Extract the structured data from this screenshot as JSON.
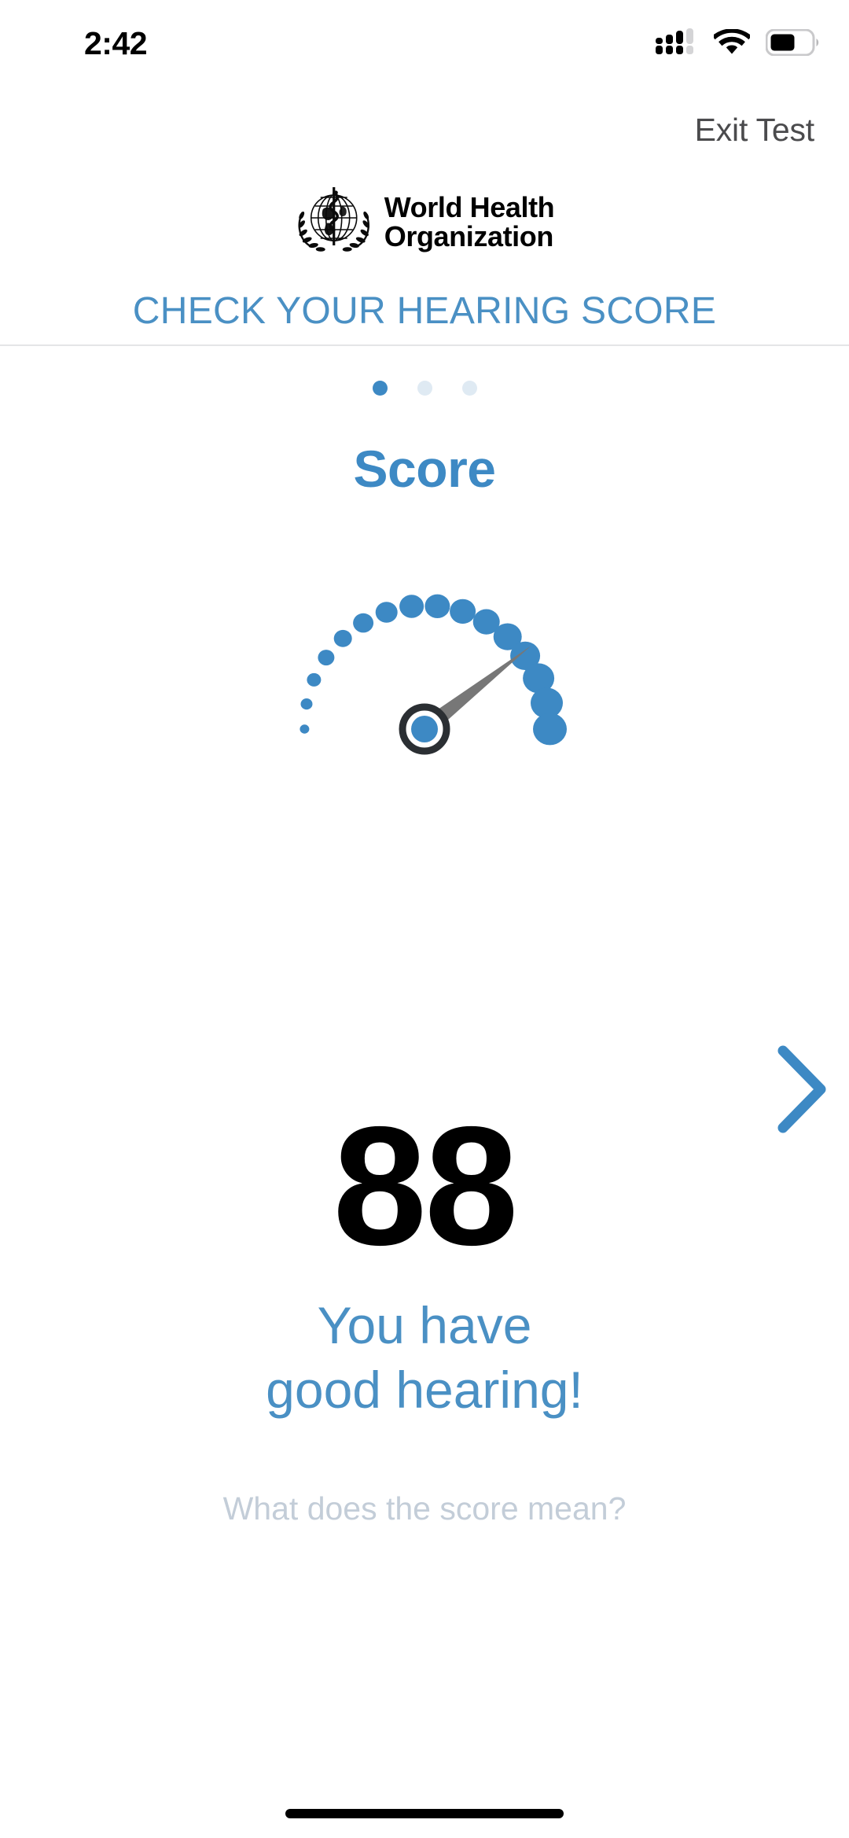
{
  "status_bar": {
    "time": "2:42",
    "cellular_icon": "cellular-signal-icon",
    "cellular_bars_filled": 3,
    "cellular_bars_total": 4,
    "wifi_icon": "wifi-icon",
    "battery_icon": "battery-icon",
    "battery_level_percent": 55
  },
  "header": {
    "exit_label": "Exit Test",
    "logo_line1": "World Health",
    "logo_line2": "Organization",
    "logo_icon": "who-emblem-icon",
    "title": "CHECK YOUR HEARING SCORE"
  },
  "pager": {
    "total": 3,
    "active_index": 0
  },
  "main": {
    "section_title": "Score",
    "score_value": "88",
    "result_line1": "You have",
    "result_line2": "good hearing!",
    "score_meaning_link": "What does the score mean?",
    "next_icon": "chevron-right-icon"
  },
  "chart_data": {
    "type": "gauge",
    "title": "Score",
    "value": 88,
    "min": 0,
    "max": 100,
    "display_value": "88",
    "needle_angle_deg": 38,
    "start_angle_deg": 180,
    "end_angle_deg": 0,
    "marker_count": 16,
    "marker_sizes": [
      12,
      15,
      18,
      21,
      23,
      26,
      28,
      31,
      32,
      33,
      34,
      36,
      38,
      40,
      41,
      43
    ],
    "marker_color": "#3d89c4",
    "needle_color": "#777777",
    "hub_ring_color": "#2b2f33",
    "hub_center_color": "#3d89c4",
    "legend": [],
    "xlabel": "",
    "ylabel": "",
    "grid": false
  },
  "colors": {
    "accent_blue": "#3d89c4",
    "title_blue": "#4a90c4",
    "muted_gray": "#c3cdd8",
    "dot_inactive": "#dfeaf3",
    "divider": "#e4e5e7",
    "exit_text": "#4b4b4d",
    "score_black": "#000000"
  },
  "footer": {
    "home_indicator": "home-indicator"
  }
}
